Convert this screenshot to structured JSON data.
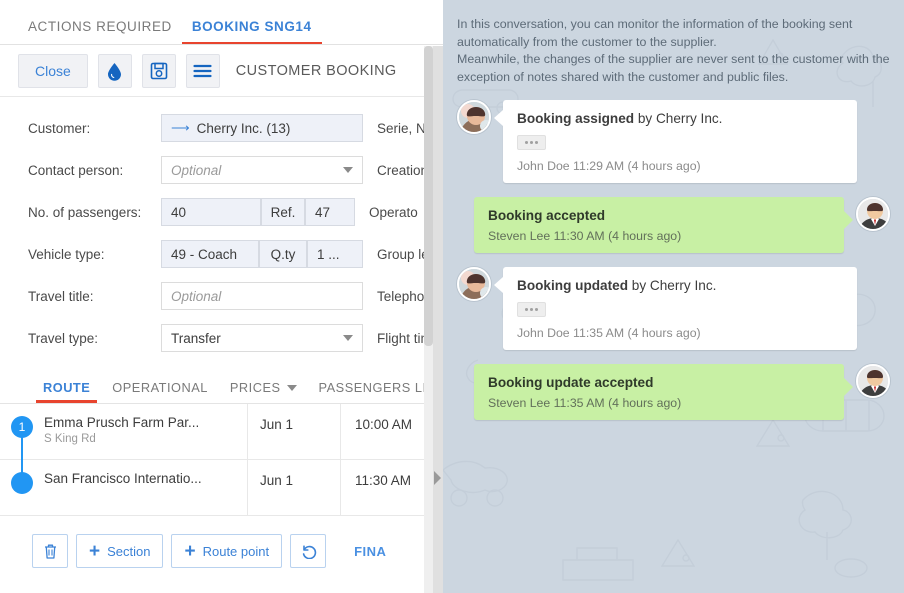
{
  "top_tabs": [
    {
      "label": "ACTIONS REQUIRED",
      "active": false
    },
    {
      "label": "BOOKING SNG14",
      "active": true
    }
  ],
  "toolbar": {
    "close_label": "Close",
    "droplet_icon": "droplet-icon",
    "save_icon": "save-icon",
    "menu_icon": "hamburger-menu-icon",
    "title": "CUSTOMER BOOKING"
  },
  "form": {
    "rows": [
      {
        "label": "Customer:",
        "type": "value",
        "value": "Cherry Inc. (13)",
        "has_arrow": true,
        "right_label": "Serie, Nu"
      },
      {
        "label": "Contact person:",
        "type": "select",
        "value": "Optional",
        "placeholder": true,
        "right_label": "Creation"
      },
      {
        "label": "No. of passengers:",
        "type": "group",
        "value": "40",
        "mid": "Ref.",
        "extra": "47",
        "right_label": "Operato"
      },
      {
        "label": "Vehicle type:",
        "type": "group2",
        "value": "49 - Coach",
        "mid": "Q.ty",
        "extra": "1 ...",
        "right_label": "Group le"
      },
      {
        "label": "Travel title:",
        "type": "text",
        "value": "Optional",
        "placeholder": true,
        "right_label": "Telephon"
      },
      {
        "label": "Travel type:",
        "type": "select",
        "value": "Transfer",
        "placeholder": false,
        "right_label": "Flight tim"
      }
    ]
  },
  "route_tabs": [
    {
      "label": "ROUTE",
      "active": true,
      "caret": false
    },
    {
      "label": "OPERATIONAL",
      "active": false,
      "caret": false
    },
    {
      "label": "PRICES",
      "active": false,
      "caret": true
    },
    {
      "label": "PASSENGERS LIST",
      "active": false,
      "caret": false
    }
  ],
  "route_rows": [
    {
      "marker": "1",
      "numbered": true,
      "name": "Emma Prusch Farm Par...",
      "sub": "S King Rd",
      "date": "Jun 1",
      "time": "10:00 AM"
    },
    {
      "marker": "",
      "numbered": false,
      "name": "San Francisco Internatio...",
      "sub": "",
      "date": "Jun 1",
      "time": "11:30 AM"
    }
  ],
  "bottom_actions": {
    "delete_icon": "trash-icon",
    "section_label": "Section",
    "route_point_label": "Route point",
    "undo_icon": "undo-icon",
    "finalize_label": "FINA"
  },
  "chat": {
    "intro_line1": "In this conversation, you can monitor the information of the booking sent automatically from the customer to the supplier.",
    "intro_line2": "Meanwhile, the changes of the supplier are never sent to the customer with the exception of notes shared with the customer and public files.",
    "messages": [
      {
        "side": "in",
        "title_bold": "Booking assigned",
        "title_rest": " by Cherry Inc.",
        "has_dots": true,
        "meta": "John Doe 11:29 AM (4 hours ago)",
        "avatar": "woman-photo-avatar"
      },
      {
        "side": "out",
        "title_bold": "Booking accepted",
        "title_rest": "",
        "has_dots": false,
        "meta": "Steven Lee 11:30 AM (4 hours ago)",
        "avatar": "man-suit-avatar"
      },
      {
        "side": "in",
        "title_bold": "Booking updated",
        "title_rest": " by Cherry Inc.",
        "has_dots": true,
        "meta": "John Doe 11:35 AM (4 hours ago)",
        "avatar": "woman-photo-avatar"
      },
      {
        "side": "out",
        "title_bold": "Booking update accepted",
        "title_rest": "",
        "has_dots": false,
        "meta": "Steven Lee 11:35 AM (4 hours ago)",
        "avatar": "man-suit-avatar"
      }
    ]
  },
  "colors": {
    "accent_blue": "#3b82d6",
    "active_tab_underline": "#e8442e",
    "marker_blue": "#2196f3",
    "accepted_green": "#c8f0a4",
    "chat_bg": "#ccd6e0"
  }
}
